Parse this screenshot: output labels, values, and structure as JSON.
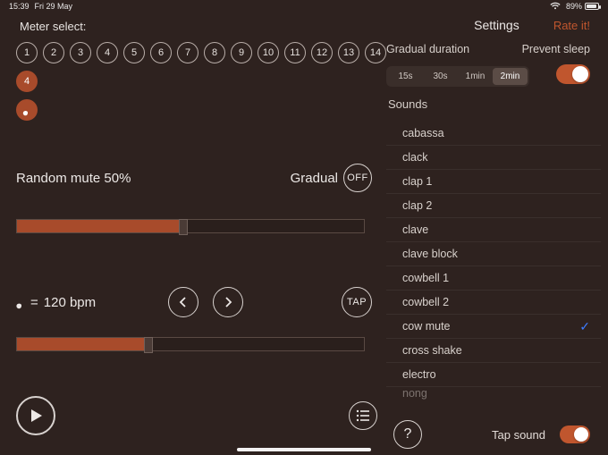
{
  "status": {
    "time": "15:39",
    "date": "Fri 29 May",
    "battery_pct": "89%"
  },
  "left": {
    "meter_select_label": "Meter select:",
    "meters": [
      "1",
      "2",
      "3",
      "4",
      "5",
      "6",
      "7",
      "8",
      "9",
      "10",
      "11",
      "12",
      "13",
      "14"
    ],
    "selected_meter": "4",
    "random_mute_label": "Random mute 50%",
    "gradual_label": "Gradual",
    "gradual_state": "OFF",
    "bpm_prefix": "= ",
    "bpm_value": "120 bpm",
    "tap_label": "TAP",
    "slider1_pct": 48,
    "slider2_pct": 38
  },
  "right": {
    "settings_title": "Settings",
    "rate_label": "Rate it!",
    "gradual_duration_label": "Gradual duration",
    "prevent_sleep_label": "Prevent sleep",
    "seg_options": [
      "15s",
      "30s",
      "1min",
      "2min"
    ],
    "seg_selected_index": 3,
    "sounds_title": "Sounds",
    "sounds": [
      "cabassa",
      "clack",
      "clap 1",
      "clap 2",
      "clave",
      "clave block",
      "cowbell 1",
      "cowbell 2",
      "cow mute",
      "cross shake",
      "electro"
    ],
    "sounds_cut": "nong",
    "selected_sound_index": 8,
    "tap_sound_label": "Tap sound"
  }
}
